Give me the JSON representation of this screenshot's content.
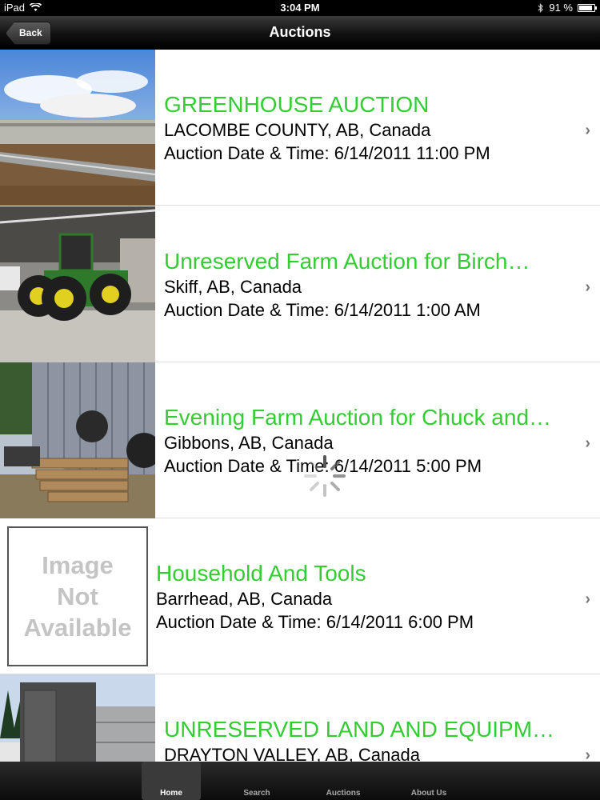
{
  "status": {
    "device": "iPad",
    "time": "3:04 PM",
    "battery": "91 %",
    "battery_level": 0.91
  },
  "nav": {
    "back_label": "Back",
    "title": "Auctions"
  },
  "list": {
    "items": [
      {
        "title": "GREENHOUSE AUCTION",
        "location": "LACOMBE COUNTY, AB, Canada",
        "date": "Auction Date & Time: 6/14/2011 11:00 PM",
        "image": "greenhouse-photo"
      },
      {
        "title": "Unreserved Farm Auction for Birch…",
        "location": "Skiff, AB, Canada",
        "date": "Auction Date & Time: 6/14/2011 1:00 AM",
        "image": "tractor-photo"
      },
      {
        "title": "Evening Farm Auction for Chuck and…",
        "location": "Gibbons, AB, Canada",
        "date": "Auction Date & Time: 6/14/2011 5:00 PM",
        "image": "lumber-photo"
      },
      {
        "title": "Household And Tools",
        "location": "Barrhead, AB, Canada",
        "date": "Auction Date & Time: 6/14/2011 6:00 PM",
        "image": "image-not-available",
        "placeholder_text": "Image Not Available"
      },
      {
        "title": "UNRESERVED LAND AND EQUIPM…",
        "location": "DRAYTON VALLEY, AB, Canada",
        "date": "",
        "image": "trailer-photo"
      }
    ]
  },
  "tabs": [
    {
      "label": "Home",
      "active": true
    },
    {
      "label": "Search",
      "active": false
    },
    {
      "label": "Auctions",
      "active": false
    },
    {
      "label": "About Us",
      "active": false
    }
  ],
  "colors": {
    "title_green": "#33cc33",
    "chevron": "#777777"
  }
}
